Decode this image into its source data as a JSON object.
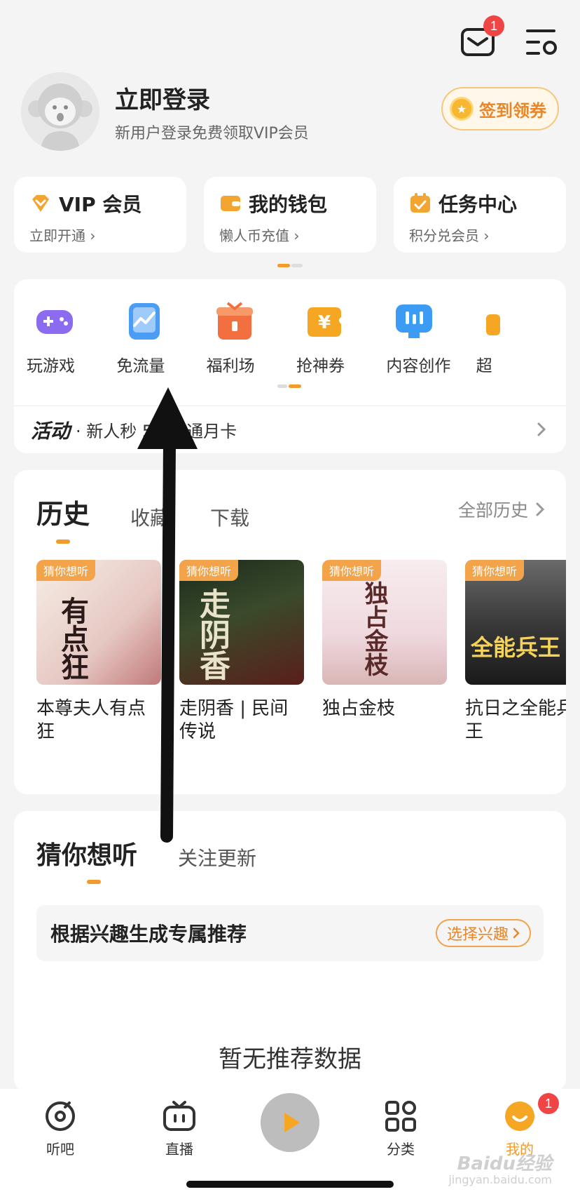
{
  "header": {
    "message_badge": "1"
  },
  "profile": {
    "title": "立即登录",
    "subtitle": "新用户登录免费领取VIP会员",
    "checkin_label": "签到领券"
  },
  "cards": [
    {
      "title": "VIP 会员",
      "sub": "立即开通",
      "color": "#f2a531"
    },
    {
      "title": "我的钱包",
      "sub": "懒人币充值",
      "color": "#f2a531"
    },
    {
      "title": "任务中心",
      "sub": "积分兑会员",
      "color": "#f2a531"
    }
  ],
  "tools": [
    {
      "label": "玩游戏",
      "icon": "gamepad-icon",
      "color": "#8b6cf0"
    },
    {
      "label": "免流量",
      "icon": "phone-chart-icon",
      "color": "#4a9cf5"
    },
    {
      "label": "福利场",
      "icon": "gift-box-icon",
      "color": "#f27040"
    },
    {
      "label": "抢神券",
      "icon": "coupon-icon",
      "color": "#f5a623"
    },
    {
      "label": "内容创作",
      "icon": "monitor-icon",
      "color": "#3c9cf5"
    },
    {
      "label": "超",
      "icon": "more-icon",
      "color": "#f5a623"
    }
  ],
  "activity": {
    "tag": "活动",
    "text": "· 新人秒         5元开通月卡"
  },
  "history": {
    "tab_history": "历史",
    "tab_favorite": "收藏",
    "tab_download": "下载",
    "all_label": "全部历史",
    "books": [
      {
        "tag": "猜你想听",
        "title": "本尊夫人有点狂",
        "art": "有点狂"
      },
      {
        "tag": "猜你想听",
        "title": "走阴香 | 民间传说",
        "art": "走阴香"
      },
      {
        "tag": "猜你想听",
        "title": "独占金枝",
        "art": "独占金枝"
      },
      {
        "tag": "猜你想听",
        "title": "抗日之全能兵王",
        "art": "全能兵王"
      }
    ]
  },
  "guess": {
    "tab_active": "猜你想听",
    "tab_follow": "关注更新",
    "interest_text": "根据兴趣生成专属推荐",
    "interest_button": "选择兴趣",
    "empty_text": "暂无推荐数据"
  },
  "tabbar": {
    "listen": "听吧",
    "live": "直播",
    "category": "分类",
    "mine": "我的",
    "mine_badge": "1"
  },
  "watermark": {
    "text": "Baidu经验",
    "sub": "jingyan.baidu.com"
  }
}
